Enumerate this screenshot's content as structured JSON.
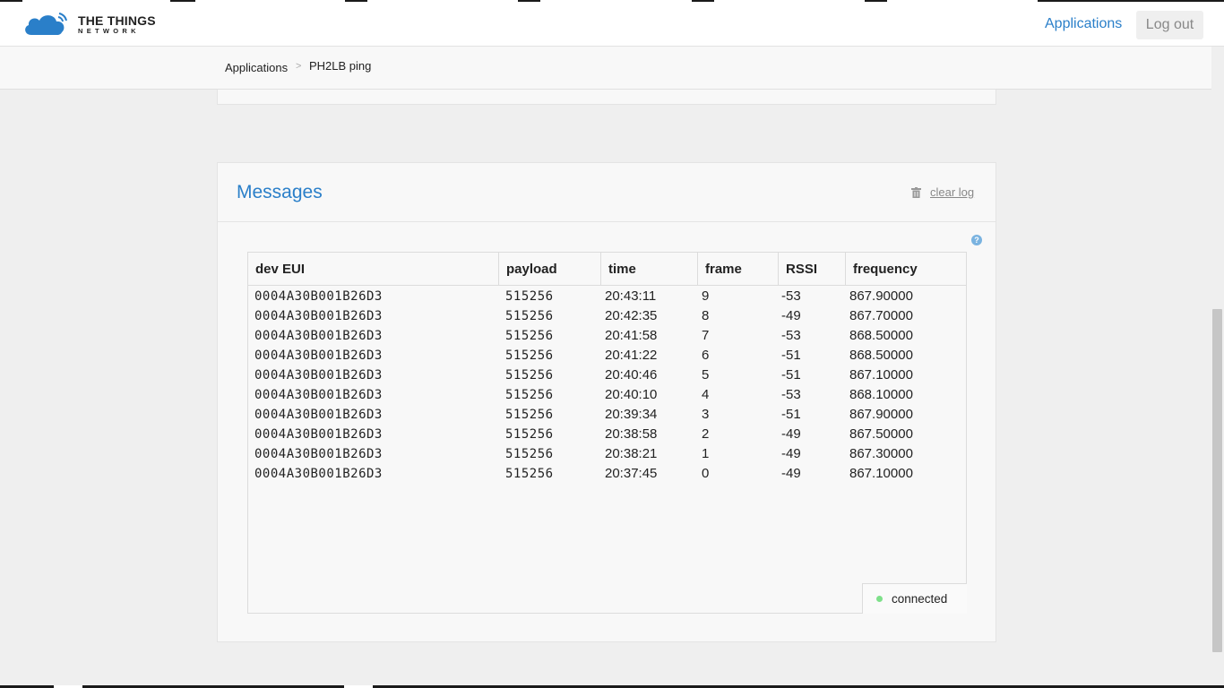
{
  "brand": {
    "line1": "THE THINGS",
    "line2": "NETWORK"
  },
  "nav": {
    "applications": "Applications",
    "logout": "Log out"
  },
  "breadcrumb": {
    "root": "Applications",
    "separator": ">",
    "current": "PH2LB ping"
  },
  "messages": {
    "title": "Messages",
    "clear_log": "clear log",
    "help": "?",
    "status": "connected",
    "status_color": "#7ee08a",
    "columns": [
      "dev EUI",
      "payload",
      "time",
      "frame",
      "RSSI",
      "frequency"
    ],
    "rows": [
      [
        "0004A30B001B26D3",
        "515256",
        "20:43:11",
        "9",
        "-53",
        "867.90000"
      ],
      [
        "0004A30B001B26D3",
        "515256",
        "20:42:35",
        "8",
        "-49",
        "867.70000"
      ],
      [
        "0004A30B001B26D3",
        "515256",
        "20:41:58",
        "7",
        "-53",
        "868.50000"
      ],
      [
        "0004A30B001B26D3",
        "515256",
        "20:41:22",
        "6",
        "-51",
        "868.50000"
      ],
      [
        "0004A30B001B26D3",
        "515256",
        "20:40:46",
        "5",
        "-51",
        "867.10000"
      ],
      [
        "0004A30B001B26D3",
        "515256",
        "20:40:10",
        "4",
        "-53",
        "868.10000"
      ],
      [
        "0004A30B001B26D3",
        "515256",
        "20:39:34",
        "3",
        "-51",
        "867.90000"
      ],
      [
        "0004A30B001B26D3",
        "515256",
        "20:38:58",
        "2",
        "-49",
        "867.50000"
      ],
      [
        "0004A30B001B26D3",
        "515256",
        "20:38:21",
        "1",
        "-49",
        "867.30000"
      ],
      [
        "0004A30B001B26D3",
        "515256",
        "20:37:45",
        "0",
        "-49",
        "867.10000"
      ]
    ]
  },
  "colors": {
    "accent": "#2a7fc9",
    "background": "#efefef",
    "card": "#f8f8f8"
  }
}
